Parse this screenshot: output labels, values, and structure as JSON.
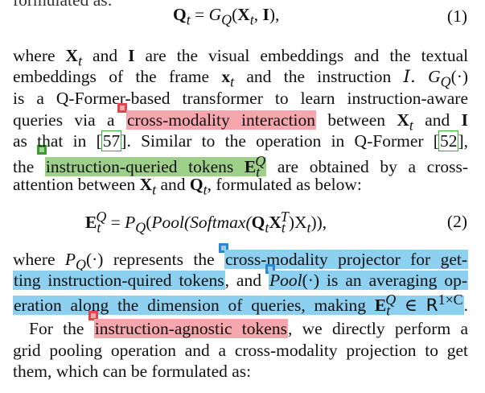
{
  "top_cut_text": "formulated as:",
  "eq1": {
    "lhs": "Q",
    "lhs_sub": "t",
    "rhs_fn": "G",
    "rhs_fn_sub": "Q",
    "arg1": "X",
    "arg1_sub": "t",
    "arg2": "I",
    "number": "(1)"
  },
  "para1": {
    "l1": [
      "where",
      "X_t",
      "and",
      "I",
      "are",
      "the",
      "visual",
      "embeddings",
      "and",
      "the",
      "textual"
    ],
    "l2": [
      "embeddings",
      "of",
      "the",
      "frame",
      "x_t",
      "and",
      "the",
      "instruction",
      "I.",
      "G_Q(·)"
    ],
    "l3_text": "is a Q-Former-based transformer to learn instruction-aware",
    "l4_pre": "queries via a",
    "l4_hl": "cross-modality interaction",
    "l4_post": "between",
    "l4_end": "and",
    "l5_pre": "as that in",
    "l5_cite1": "57",
    "l5_mid": ". Similar to the operation in Q-Former",
    "l5_cite2": "52",
    "l5_end": ",",
    "l6_pre": "the",
    "l6_hl": "instruction-queried tokens",
    "l6_post": "are obtained by a cross-",
    "l7_text": "attention between",
    "l7_mid": "and",
    "l7_end": ", formulated as below:"
  },
  "eq2": {
    "lhs": "E",
    "lhs_sup": "Q",
    "lhs_sub": "t",
    "fn": "P",
    "fn_sub": "Q",
    "inner": "Pool(Softmax(",
    "close": ")X",
    "number": "(2)"
  },
  "para2": {
    "l1_pre": "where",
    "l1_mid": "represents the",
    "l1_hl": "cross-modality projector for get-",
    "l2_hl": "ting instruction-quired tokens",
    "l2_mid": ", and",
    "l2_hl2": "is an averaging op-",
    "l3_hl": "eration along the dimension of queries, making",
    "l3_r": "R",
    "l3_sup": "1×C",
    "l3_end": "."
  },
  "para3": {
    "l1_pre": "For the",
    "l1_hl": "instruction-agnostic tokens",
    "l1_post": ", we directly perform a",
    "l2": "grid pooling operation and a cross-modality projection to get",
    "l3": "them, which can be formulated as:"
  },
  "colors": {
    "highlight_red": "#f5a7ad",
    "highlight_green": "#9fd08a",
    "highlight_blue": "#8ed0f0",
    "marker_red": "#e0464e",
    "marker_green": "#3c9a2e",
    "marker_blue": "#2a88d0",
    "citation_box": "#2fb82f"
  }
}
